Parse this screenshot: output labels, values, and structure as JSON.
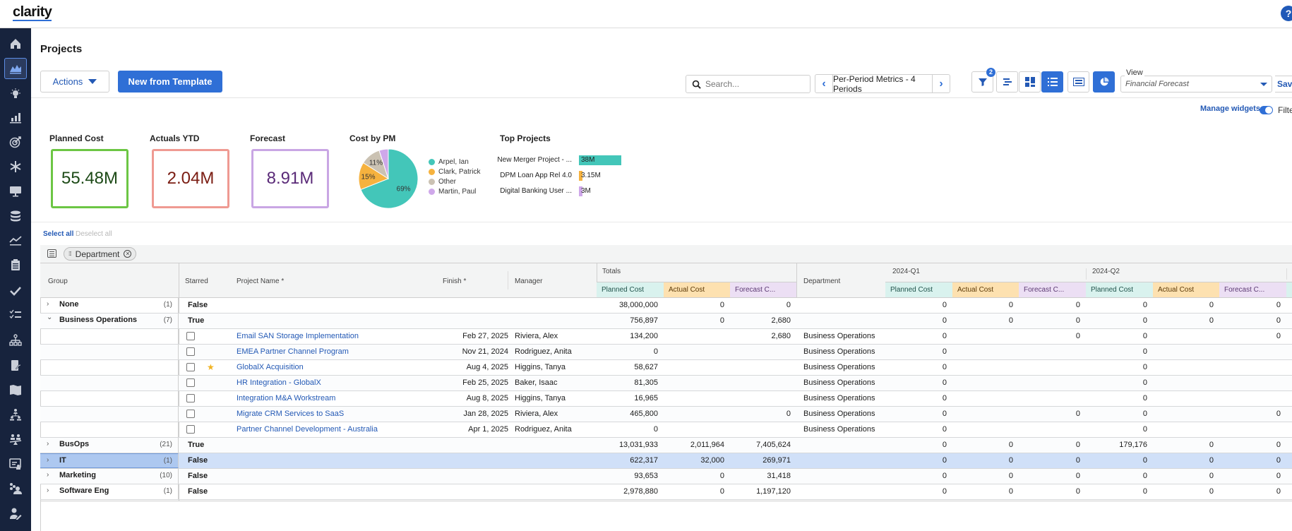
{
  "app": {
    "logo": "clarity",
    "help_label": "?"
  },
  "sidebar": {
    "items": [
      {
        "icon": "home-icon"
      },
      {
        "icon": "projects-icon",
        "active": true
      },
      {
        "icon": "ideas-icon"
      },
      {
        "icon": "reports-icon"
      },
      {
        "icon": "goals-icon"
      },
      {
        "icon": "investments-icon"
      },
      {
        "icon": "applications-icon"
      },
      {
        "icon": "data-icon"
      },
      {
        "icon": "trends-icon"
      },
      {
        "icon": "clipboard-icon"
      },
      {
        "icon": "checkmark-icon"
      },
      {
        "icon": "tasks-list-icon"
      },
      {
        "icon": "hierarchy-icon"
      },
      {
        "icon": "roadmap-phone-icon"
      },
      {
        "icon": "map-icon"
      },
      {
        "icon": "org-chart-icon"
      },
      {
        "icon": "resource-balance-icon"
      },
      {
        "icon": "timesheet-icon"
      },
      {
        "icon": "teams-icon"
      },
      {
        "icon": "user-edit-icon"
      }
    ]
  },
  "header": {
    "title": "Projects",
    "actions_label": "Actions",
    "new_template_label": "New from Template",
    "search_placeholder": "Search...",
    "period_label": "Per-Period Metrics - 4 Periods",
    "filter_count": "2",
    "view_legend": "View",
    "view_value": "Financial Forecast",
    "save_label": "Save"
  },
  "widgets_bar": {
    "manage_label": "Manage widgets",
    "filter_label": "Filter",
    "filter_toggle_on": true
  },
  "widgets": {
    "planned": {
      "title": "Planned Cost",
      "value": "55.48M",
      "border": "#6cc644",
      "color": "#1d4a17"
    },
    "actuals": {
      "title": "Actuals YTD",
      "value": "2.04M",
      "border": "#ef9a92",
      "color": "#7a1c12"
    },
    "forecast": {
      "title": "Forecast",
      "value": "8.91M",
      "border": "#c9a6e4",
      "color": "#5a2a78"
    },
    "cost_by_pm": {
      "title": "Cost by PM",
      "slices": [
        {
          "name": "Arpel, Ian",
          "percent": 69,
          "label": "69%",
          "color": "#43c6b9"
        },
        {
          "name": "Clark, Patrick",
          "percent": 15,
          "label": "15%",
          "color": "#f6b23e"
        },
        {
          "name": "Other",
          "percent": 11,
          "label": "11%",
          "color": "#cbc2b3"
        },
        {
          "name": "Martin, Paul",
          "percent": 5,
          "label": "",
          "color": "#cfa8ea"
        }
      ]
    },
    "top_projects": {
      "title": "Top Projects",
      "bars": [
        {
          "name": "New Merger Project - ...",
          "value": 38,
          "label": "38M",
          "color": "#43c6b9"
        },
        {
          "name": "DPM Loan App Rel 4.0",
          "value": 3.15,
          "label": "3.15M",
          "color": "#f6b23e"
        },
        {
          "name": "Digital Banking User ...",
          "value": 3,
          "label": "3M",
          "color": "#cfa8ea"
        }
      ]
    }
  },
  "selection": {
    "select_all": "Select all",
    "deselect_all": "Deselect all"
  },
  "grid": {
    "group_chip": "Department",
    "headers": {
      "group": "Group",
      "starred": "Starred",
      "project_name": "Project Name",
      "finish": "Finish",
      "manager": "Manager",
      "totals": "Totals",
      "department": "Department",
      "q1": "2024-Q1",
      "q2": "2024-Q2",
      "planned": "Planned Cost",
      "actual": "Actual Cost",
      "forecast": "Forecast C..."
    },
    "rows": [
      {
        "type": "group",
        "expanded": false,
        "name": "None",
        "count": "(1)",
        "starred": "False",
        "tp": "38,000,000",
        "ta": "0",
        "tf": "0",
        "q1p": "0",
        "q1a": "0",
        "q1f": "0",
        "q2p": "0",
        "q2a": "0",
        "q2f": "0"
      },
      {
        "type": "group",
        "expanded": true,
        "name": "Business Operations",
        "count": "(7)",
        "starred": "True",
        "tp": "756,897",
        "ta": "0",
        "tf": "2,680",
        "q1p": "0",
        "q1a": "0",
        "q1f": "0",
        "q2p": "0",
        "q2a": "0",
        "q2f": "0"
      },
      {
        "type": "item",
        "starred": false,
        "name": "Email SAN Storage Implementation",
        "finish": "Feb 27, 2025",
        "manager": "Riviera, Alex",
        "tp": "134,200",
        "ta": "",
        "tf": "2,680",
        "dept": "Business Operations",
        "q1p": "0",
        "q1a": "",
        "q1f": "0",
        "q2p": "0",
        "q2a": "",
        "q2f": "0"
      },
      {
        "type": "item",
        "starred": false,
        "name": "EMEA Partner Channel Program",
        "finish": "Nov 21, 2024",
        "manager": "Rodriguez, Anita",
        "tp": "0",
        "ta": "",
        "tf": "",
        "dept": "Business Operations",
        "q1p": "0",
        "q1a": "",
        "q1f": "",
        "q2p": "0",
        "q2a": "",
        "q2f": ""
      },
      {
        "type": "item",
        "starred": true,
        "name": "GlobalX Acquisition",
        "finish": "Aug 4, 2025",
        "manager": "Higgins, Tanya",
        "tp": "58,627",
        "ta": "",
        "tf": "",
        "dept": "Business Operations",
        "q1p": "0",
        "q1a": "",
        "q1f": "",
        "q2p": "0",
        "q2a": "",
        "q2f": ""
      },
      {
        "type": "item",
        "starred": false,
        "name": "HR Integration - GlobalX",
        "finish": "Feb 25, 2025",
        "manager": "Baker, Isaac",
        "tp": "81,305",
        "ta": "",
        "tf": "",
        "dept": "Business Operations",
        "q1p": "0",
        "q1a": "",
        "q1f": "",
        "q2p": "0",
        "q2a": "",
        "q2f": ""
      },
      {
        "type": "item",
        "starred": false,
        "name": "Integration M&A Workstream",
        "finish": "Aug 8, 2025",
        "manager": "Higgins, Tanya",
        "tp": "16,965",
        "ta": "",
        "tf": "",
        "dept": "Business Operations",
        "q1p": "0",
        "q1a": "",
        "q1f": "",
        "q2p": "0",
        "q2a": "",
        "q2f": ""
      },
      {
        "type": "item",
        "starred": false,
        "name": "Migrate CRM Services to SaaS",
        "finish": "Jan 28, 2025",
        "manager": "Riviera, Alex",
        "tp": "465,800",
        "ta": "",
        "tf": "0",
        "dept": "Business Operations",
        "q1p": "0",
        "q1a": "",
        "q1f": "0",
        "q2p": "0",
        "q2a": "",
        "q2f": "0"
      },
      {
        "type": "item",
        "starred": false,
        "name": "Partner Channel Development - Australia",
        "finish": "Apr 1, 2025",
        "manager": "Rodriguez, Anita",
        "tp": "0",
        "ta": "",
        "tf": "",
        "dept": "Business Operations",
        "q1p": "0",
        "q1a": "",
        "q1f": "",
        "q2p": "0",
        "q2a": "",
        "q2f": ""
      },
      {
        "type": "group",
        "expanded": false,
        "name": "BusOps",
        "count": "(21)",
        "starred": "True",
        "tp": "13,031,933",
        "ta": "2,011,964",
        "tf": "7,405,624",
        "q1p": "0",
        "q1a": "0",
        "q1f": "0",
        "q2p": "179,176",
        "q2a": "0",
        "q2f": "0"
      },
      {
        "type": "group",
        "expanded": false,
        "selected": true,
        "name": "IT",
        "count": "(1)",
        "starred": "False",
        "tp": "622,317",
        "ta": "32,000",
        "tf": "269,971",
        "q1p": "0",
        "q1a": "0",
        "q1f": "0",
        "q2p": "0",
        "q2a": "0",
        "q2f": "0"
      },
      {
        "type": "group",
        "expanded": false,
        "name": "Marketing",
        "count": "(10)",
        "starred": "False",
        "tp": "93,653",
        "ta": "0",
        "tf": "31,418",
        "q1p": "0",
        "q1a": "0",
        "q1f": "0",
        "q2p": "0",
        "q2a": "0",
        "q2f": "0"
      },
      {
        "type": "group",
        "expanded": false,
        "name": "Software Eng",
        "count": "(1)",
        "starred": "False",
        "tp": "2,978,880",
        "ta": "0",
        "tf": "1,197,120",
        "q1p": "0",
        "q1a": "0",
        "q1f": "0",
        "q2p": "0",
        "q2a": "0",
        "q2f": "0"
      }
    ]
  }
}
